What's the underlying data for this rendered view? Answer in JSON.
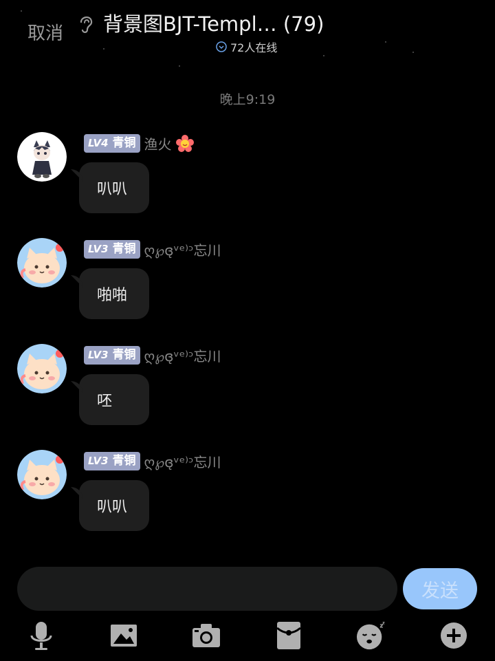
{
  "header": {
    "cancel_label": "取消",
    "title": "背景图BJT-Templ…  (79)",
    "online_count": "72人在线"
  },
  "time_label": "晚上9:19",
  "messages": [
    {
      "level": "LV4",
      "rank": "青铜",
      "nickname": "渔火",
      "text": "叭叭",
      "avatar": "cat-girl-avatar"
    },
    {
      "level": "LV3",
      "rank": "青铜",
      "nickname": "ღ℘ɞ̨ᵛᵉ⁾ᵓ忘川",
      "text": "啪啪",
      "avatar": "cartoon-cat-avatar"
    },
    {
      "level": "LV3",
      "rank": "青铜",
      "nickname": "ღ℘ɞ̨ᵛᵉ⁾ᵓ忘川",
      "text": "呸",
      "avatar": "cartoon-cat-avatar"
    },
    {
      "level": "LV3",
      "rank": "青铜",
      "nickname": "ღ℘ɞ̨ᵛᵉ⁾ᵓ忘川",
      "text": "叭叭",
      "avatar": "cartoon-cat-avatar"
    }
  ],
  "composer": {
    "send_label": "发送"
  },
  "toolbar": [
    "microphone-icon",
    "image-icon",
    "camera-icon",
    "red-packet-icon",
    "emoji-icon",
    "plus-icon"
  ],
  "colors": {
    "background": "#000000",
    "bubble": "#1f1f1f",
    "badge": "#9aa2c4",
    "send_button": "#98c6fb"
  }
}
